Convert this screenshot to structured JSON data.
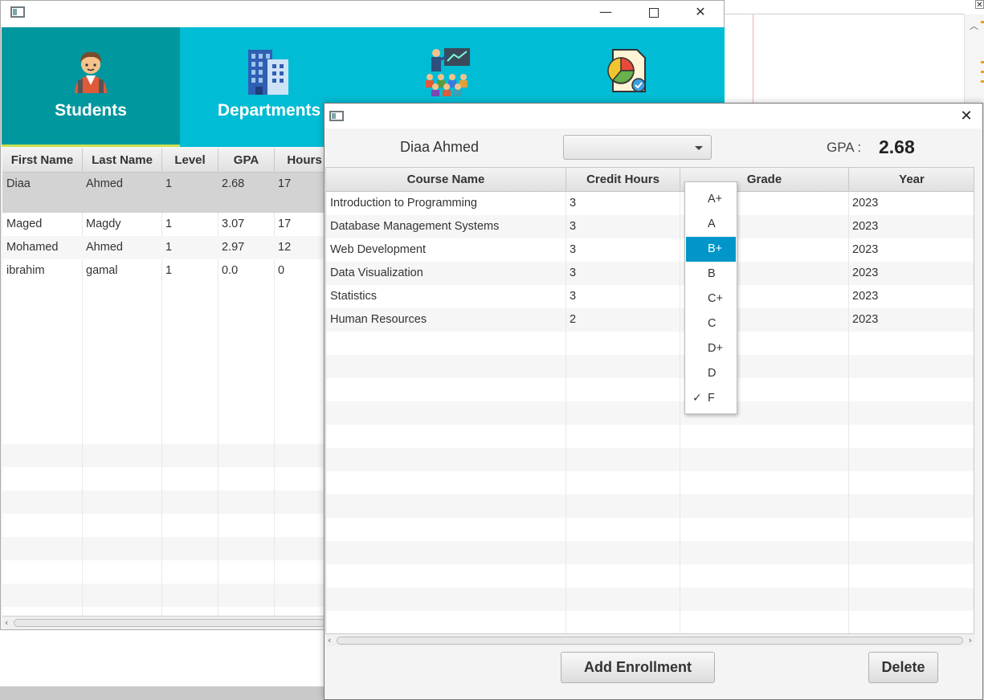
{
  "main_window": {
    "controls": {
      "minimize": "—",
      "close": "✕"
    },
    "nav_tabs": [
      {
        "label": "Students",
        "icon": "student-icon",
        "active": true
      },
      {
        "label": "Departments",
        "icon": "building-icon",
        "active": false
      },
      {
        "label": "",
        "icon": "teacher-class-icon",
        "active": false
      },
      {
        "label": "",
        "icon": "report-chart-icon",
        "active": false
      }
    ],
    "students_table": {
      "columns": [
        "First Name",
        "Last Name",
        "Level",
        "GPA",
        "Hours"
      ],
      "rows": [
        [
          "Diaa",
          "Ahmed",
          "1",
          "2.68",
          "17"
        ],
        [
          "Maged",
          "Magdy",
          "1",
          "3.07",
          "17"
        ],
        [
          "Mohamed",
          "Ahmed",
          "1",
          "2.97",
          "12"
        ],
        [
          "ibrahim",
          "gamal",
          "1",
          "0.0",
          "0"
        ]
      ],
      "selected_row": 0
    }
  },
  "dialog": {
    "close": "✕",
    "student_name": "Diaa Ahmed",
    "grade_combo_value": "",
    "gpa_label": "GPA :",
    "gpa_value": "2.68",
    "enrollments_table": {
      "columns": [
        "Course Name",
        "Credit Hours",
        "Grade",
        "Year"
      ],
      "rows": [
        [
          "Introduction to Programming",
          "3",
          "",
          "2023"
        ],
        [
          "Database Management Systems",
          "3",
          "",
          "2023"
        ],
        [
          "Web Development",
          "3",
          "",
          "2023"
        ],
        [
          "Data Visualization",
          "3",
          "",
          "2023"
        ],
        [
          "Statistics",
          "3",
          "",
          "2023"
        ],
        [
          "Human Resources",
          "2",
          "",
          "2023"
        ]
      ]
    },
    "buttons": {
      "add": "Add Enrollment",
      "delete": "Delete"
    }
  },
  "grade_dropdown": {
    "options": [
      "A+",
      "A",
      "B+",
      "B",
      "C+",
      "C",
      "D+",
      "D",
      "F"
    ],
    "highlighted": "B+",
    "checked": "F",
    "check_glyph": "✓"
  },
  "colors": {
    "nav_bg": "#00bcd4",
    "nav_active": "#00979e",
    "highlight": "#0096c9",
    "selected_row": "#d3d3d3"
  }
}
